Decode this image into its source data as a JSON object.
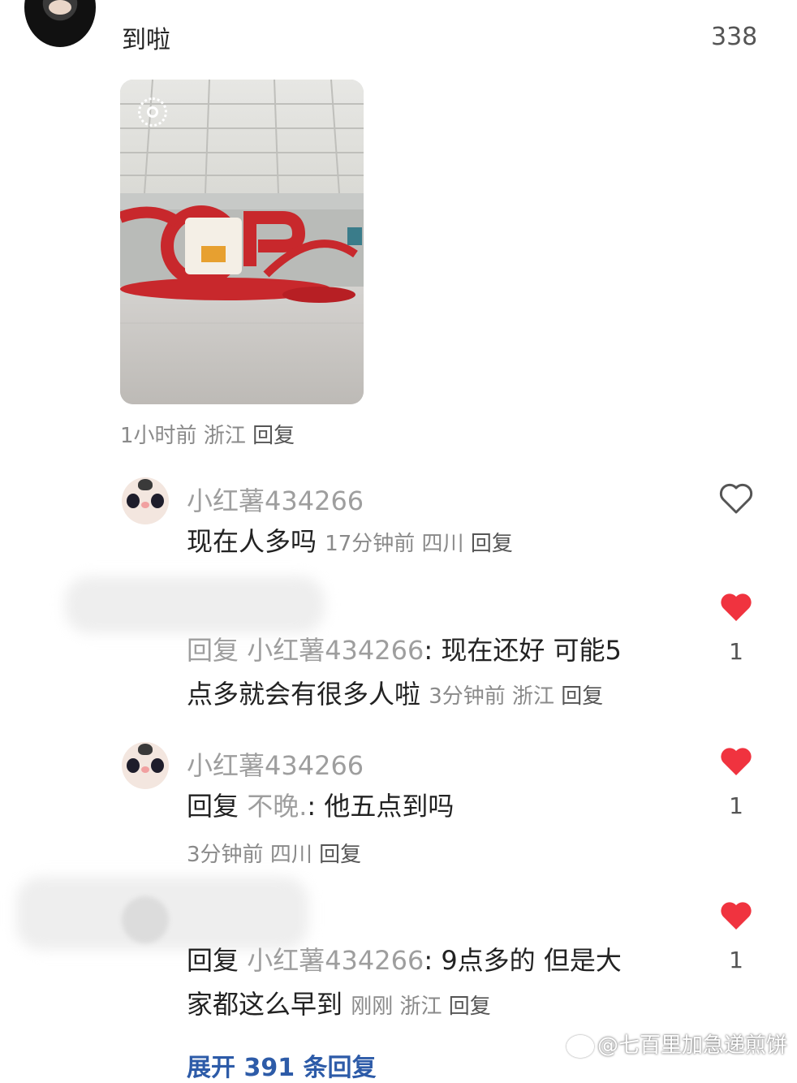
{
  "top_comment": {
    "text": "到啦",
    "like_count": "338",
    "time": "1小时前",
    "location": "浙江",
    "reply_label": "回复"
  },
  "replies": [
    {
      "username": "小红薯434266",
      "text": "现在人多吗",
      "time": "17分钟前",
      "location": "四川",
      "reply_label": "回复",
      "liked": false,
      "like_count": ""
    },
    {
      "prefix": "回复",
      "mention": "小红薯434266",
      "text_line1": ": 现在还好 可能5",
      "text_line2": "点多就会有很多人啦",
      "time": "3分钟前",
      "location": "浙江",
      "reply_label": "回复",
      "liked": true,
      "like_count": "1"
    },
    {
      "username": "小红薯434266",
      "prefix": "回复",
      "mention": "不晚.",
      "text": ": 他五点到吗",
      "time": "3分钟前",
      "location": "四川",
      "reply_label": "回复",
      "liked": true,
      "like_count": "1"
    },
    {
      "prefix": "回复",
      "mention": "小红薯434266",
      "text_line1": ": 9点多的  但是大",
      "text_line2": "家都这么早到",
      "time": "刚刚",
      "location": "浙江",
      "reply_label": "回复",
      "liked": true,
      "like_count": "1"
    }
  ],
  "expand_label": "展开 391 条回复",
  "watermark": "@七百里加急递煎饼",
  "colors": {
    "heart_active": "#f0333f",
    "heart_outline": "#555555",
    "meta_grey": "#8a8a8a"
  }
}
